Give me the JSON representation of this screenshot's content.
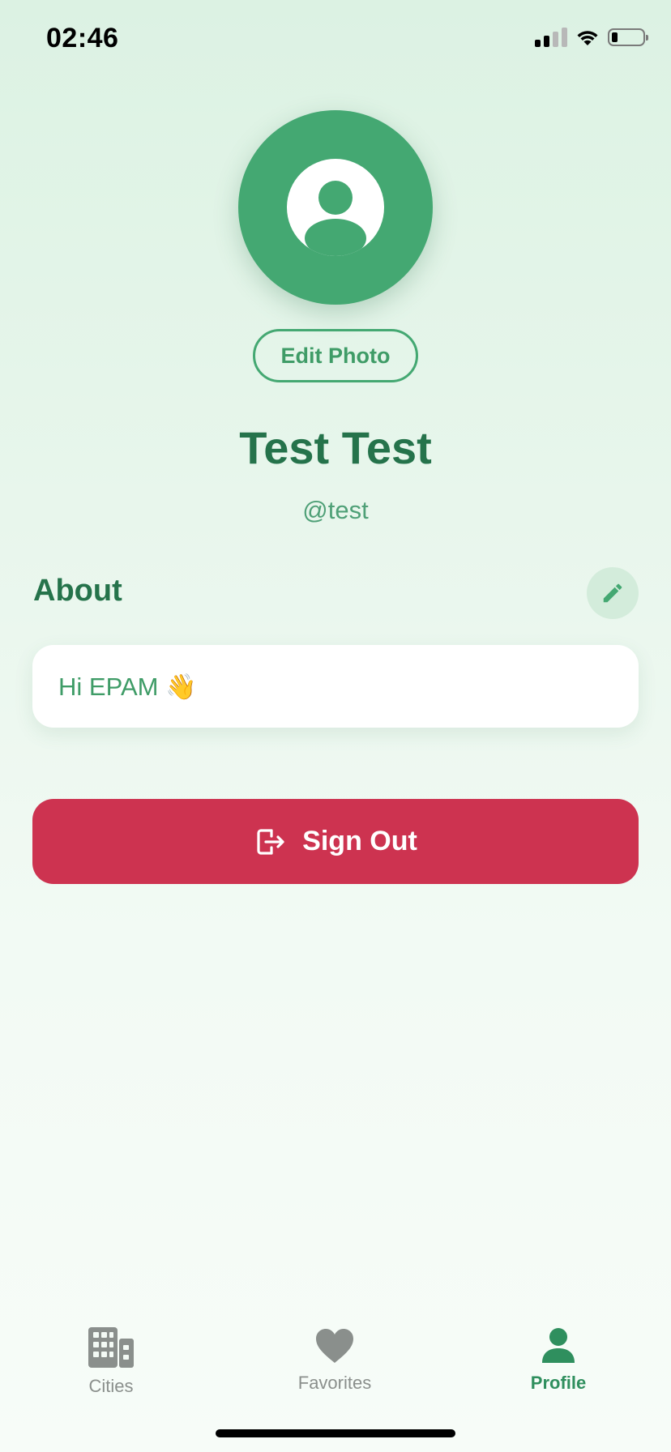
{
  "status_bar": {
    "time": "02:46",
    "signal_icon": "cellular-signal-icon",
    "wifi_icon": "wifi-icon",
    "battery_icon": "battery-low-icon"
  },
  "profile": {
    "avatar_icon": "person-circle-icon",
    "edit_photo_label": "Edit Photo",
    "name": "Test Test",
    "handle": "@test"
  },
  "about": {
    "title": "About",
    "edit_icon": "pencil-icon",
    "text": "Hi EPAM 👋"
  },
  "sign_out": {
    "icon": "sign-out-icon",
    "label": "Sign Out"
  },
  "tabs": [
    {
      "label": "Cities",
      "icon": "building-icon",
      "active": false
    },
    {
      "label": "Favorites",
      "icon": "heart-icon",
      "active": false
    },
    {
      "label": "Profile",
      "icon": "person-icon",
      "active": true
    }
  ],
  "colors": {
    "brand_green": "#44a872",
    "dark_green": "#25734b",
    "danger_red": "#cd3350",
    "inactive_tab": "#8a8f8c"
  }
}
